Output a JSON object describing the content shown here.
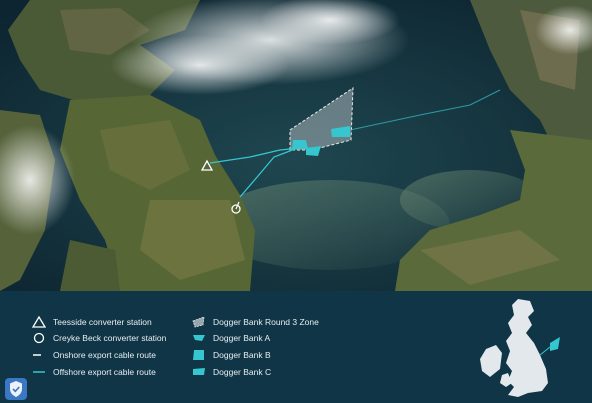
{
  "legend": {
    "items": [
      {
        "label": "Teesside converter station",
        "icon": "triangle-outline-icon"
      },
      {
        "label": "Creyke Beck converter station",
        "icon": "circle-outline-icon"
      },
      {
        "label": "Onshore export cable route",
        "icon": "white-line-icon"
      },
      {
        "label": "Offshore export cable route",
        "icon": "teal-line-icon"
      },
      {
        "label": "Dogger Bank Round 3 Zone",
        "icon": "grey-zone-icon"
      },
      {
        "label": "Dogger Bank A",
        "icon": "teal-zone-a-icon"
      },
      {
        "label": "Dogger Bank B",
        "icon": "teal-zone-b-icon"
      },
      {
        "label": "Dogger Bank C",
        "icon": "teal-zone-c-icon"
      }
    ]
  },
  "colors": {
    "panel_bg": "#0f3547",
    "cable_teal": "#35c6cf",
    "zone_grey": "#c7ccd0",
    "text": "#e8eef1",
    "badge_blue": "#3a78c3"
  }
}
